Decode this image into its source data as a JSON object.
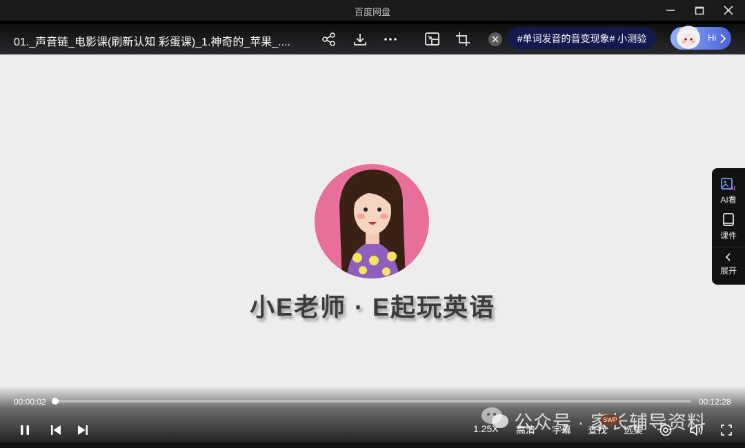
{
  "window": {
    "title": "百度网盘"
  },
  "player": {
    "video_title": "01._声音链_电影课(刷新认知 彩蛋课)_1.神奇的_苹果_....",
    "promo_label": "#单词发音的音变现象# 小测验",
    "hi_label": "Hi",
    "brand_text": "小E老师 · E起玩英语",
    "current_time": "00:00:02",
    "total_time": "00:12:28",
    "progress_fraction": 0.003,
    "speed_label": "1.25X",
    "quality_label": "高清",
    "subtitle_label": "字幕",
    "search_label": "查找",
    "episodes_label": "选集"
  },
  "side_panel": {
    "ai_label": "AI看",
    "courseware_label": "课件",
    "expand_label": "展开"
  },
  "watermark": {
    "text": "公众号 · 家长辅导资料",
    "badge": "SWP"
  },
  "icons": [
    "minimize-icon",
    "maximize-icon",
    "close-icon",
    "share-icon",
    "download-icon",
    "more-icon",
    "picture-in-picture-icon",
    "crop-icon",
    "dismiss-icon",
    "chevron-right-icon",
    "ai-image-icon",
    "book-icon",
    "chevron-left-icon",
    "pause-icon",
    "previous-icon",
    "next-icon",
    "view-icon",
    "volume-icon",
    "fullscreen-icon",
    "wechat-icon"
  ]
}
